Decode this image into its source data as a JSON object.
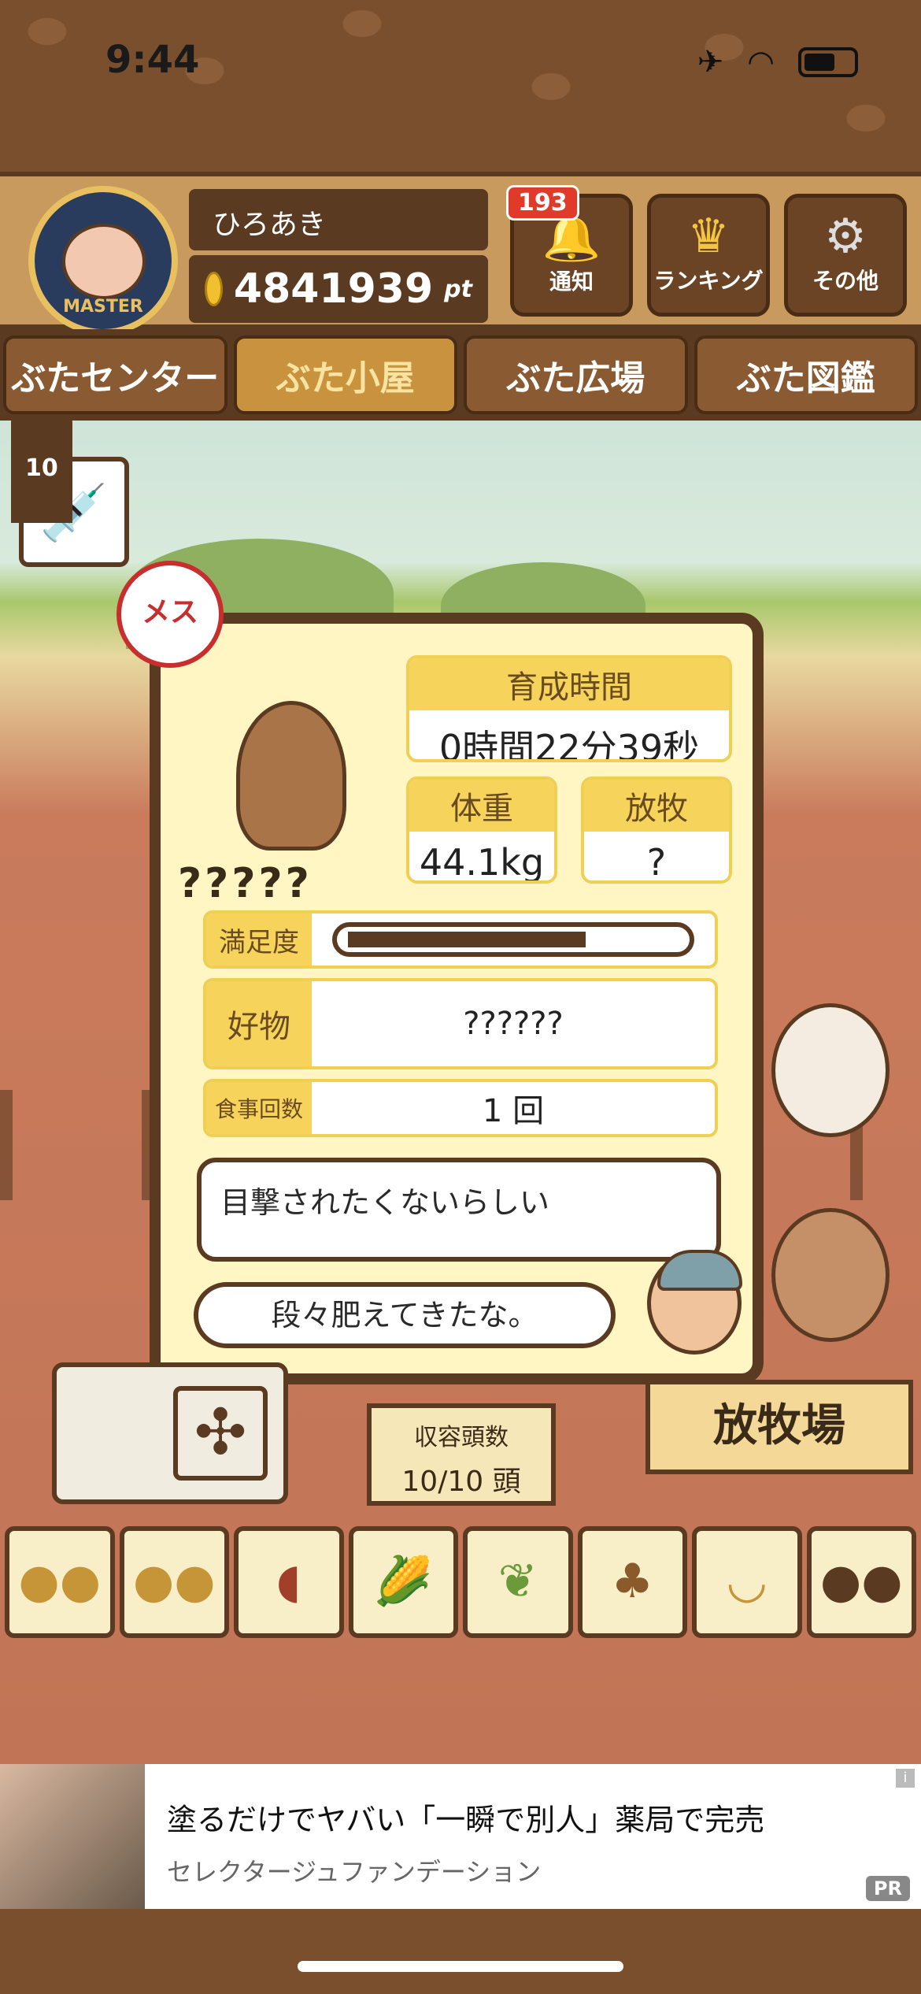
{
  "status_bar": {
    "time": "9:44",
    "airplane": "airplane-icon",
    "wifi": "wifi-icon"
  },
  "header": {
    "badge_label": "MASTER",
    "player_name": "ひろあき",
    "points_value": "4841939",
    "points_unit": "pt",
    "notify_count": "193",
    "buttons": {
      "notify": "通知",
      "ranking": "ランキング",
      "other": "その他"
    }
  },
  "tabs": [
    {
      "label": "ぶたセンター"
    },
    {
      "label": "ぶた小屋"
    },
    {
      "label": "ぶた広場"
    },
    {
      "label": "ぶた図鑑"
    }
  ],
  "scene": {
    "syringe_count": "10"
  },
  "panel": {
    "gender": "メス",
    "pig_name": "?????",
    "raise_time_label": "育成時間",
    "raise_time_value": "0時間22分39秒",
    "weight_label": "体重",
    "weight_value": "44.1kg",
    "graze_label": "放牧",
    "graze_value": "?",
    "satisfaction_label": "満足度",
    "satisfaction_level": 0.72,
    "favorite_label": "好物",
    "favorite_value": "??????",
    "meals_label": "食事回数",
    "meals_value": "1 回",
    "thought": "目撃されたくないらしい",
    "speech": "段々肥えてきたな。"
  },
  "bottom": {
    "capacity_label": "収容頭数",
    "capacity_value": "10/10 頭",
    "graze_sign": "放牧場"
  },
  "ad": {
    "title": "塗るだけでヤバい「一瞬で別人」薬局で完売",
    "subtitle": "セレクタージュファンデーション",
    "pr": "PR"
  }
}
